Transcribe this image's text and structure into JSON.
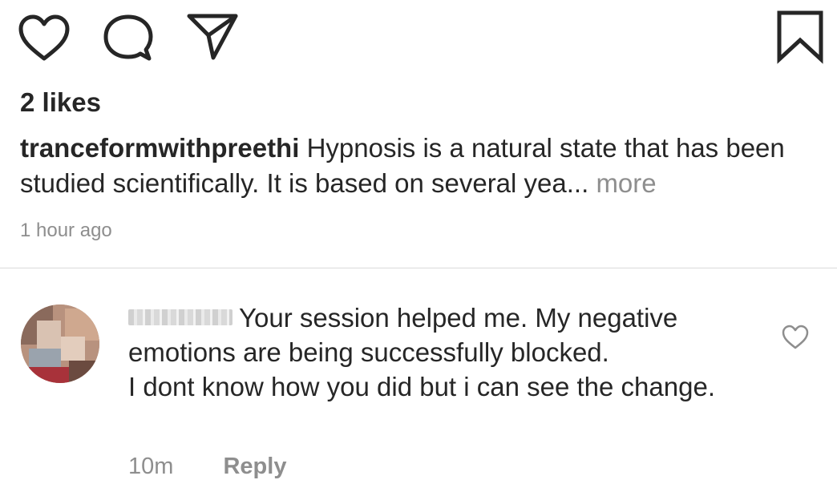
{
  "actions": {
    "like_icon": "heart-outline-icon",
    "comment_icon": "speech-bubble-icon",
    "share_icon": "paper-plane-icon",
    "save_icon": "bookmark-outline-icon"
  },
  "post": {
    "likes": "2 likes",
    "username": "tranceformwithpreethi",
    "caption": "Hypnosis is a natural state that has been studied scientifically. It is based on several yea",
    "ellipsis": "...",
    "more_label": "more",
    "timestamp": "1 hour ago"
  },
  "comment": {
    "text": "Your session helped me. My negative emotions are being successfully blocked.\nI dont know how you did but i can see the change.",
    "time": "10m",
    "reply_label": "Reply",
    "like_icon": "heart-outline-icon"
  },
  "colors": {
    "text": "#262626",
    "secondary": "#8e8e8e",
    "divider": "#dbdbdb",
    "background": "#ffffff"
  }
}
